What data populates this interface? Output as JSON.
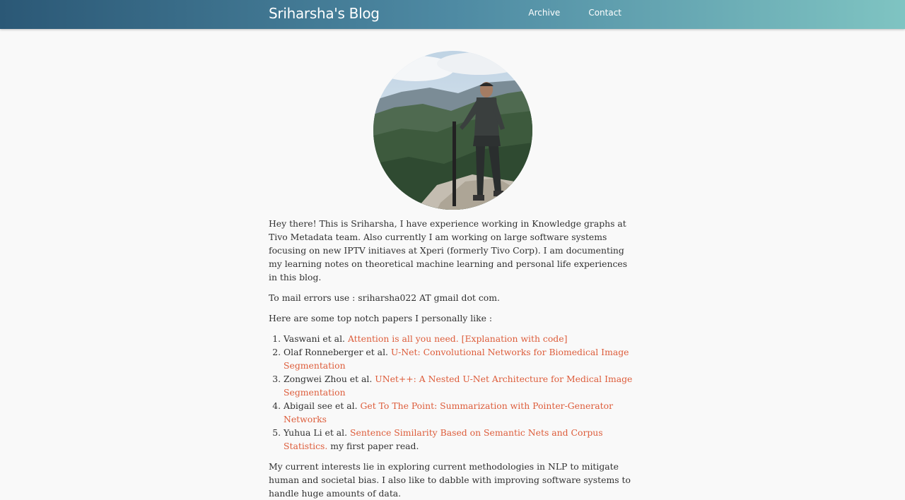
{
  "header": {
    "site_title": "Sriharsha's Blog",
    "nav": [
      {
        "label": "Archive"
      },
      {
        "label": "Contact"
      }
    ]
  },
  "intro": "Hey there! This is Sriharsha, I have experience working in Knowledge graphs at Tivo Metadata team. Also currently I am working on large software systems focusing on new IPTV initiaves at Xperi (formerly Tivo Corp). I am documenting my learning notes on theoretical machine learning and personal life experiences in this blog.",
  "mail_note": "To mail errors use : sriharsha022 AT gmail dot com.",
  "papers_heading": "Here are some top notch papers I personally like :",
  "papers": [
    {
      "authors": "Vaswani et al.",
      "title": "Attention is all you need. [Explanation with code]",
      "note": ""
    },
    {
      "authors": "Olaf Ronneberger et al.",
      "title": "U-Net: Convolutional Networks for Biomedical Image Segmentation",
      "note": ""
    },
    {
      "authors": "Zongwei Zhou et al.",
      "title": "UNet++: A Nested U-Net Architecture for Medical Image Segmentation",
      "note": ""
    },
    {
      "authors": "Abigail see et al.",
      "title": "Get To The Point: Summarization with Pointer-Generator Networks",
      "note": ""
    },
    {
      "authors": "Yuhua Li et al.",
      "title": "Sentence Similarity Based on Semantic Nets and Corpus Statistics.",
      "note": "my first paper read."
    }
  ],
  "interests": "My current interests lie in exploring current methodologies in NLP to mitigate human and societal bias. I also like to dabble with improving software systems to handle huge amounts of data.",
  "colors": {
    "link": "#dd5c3a",
    "header_start": "#2b5876",
    "header_end": "#7fc4c2"
  }
}
